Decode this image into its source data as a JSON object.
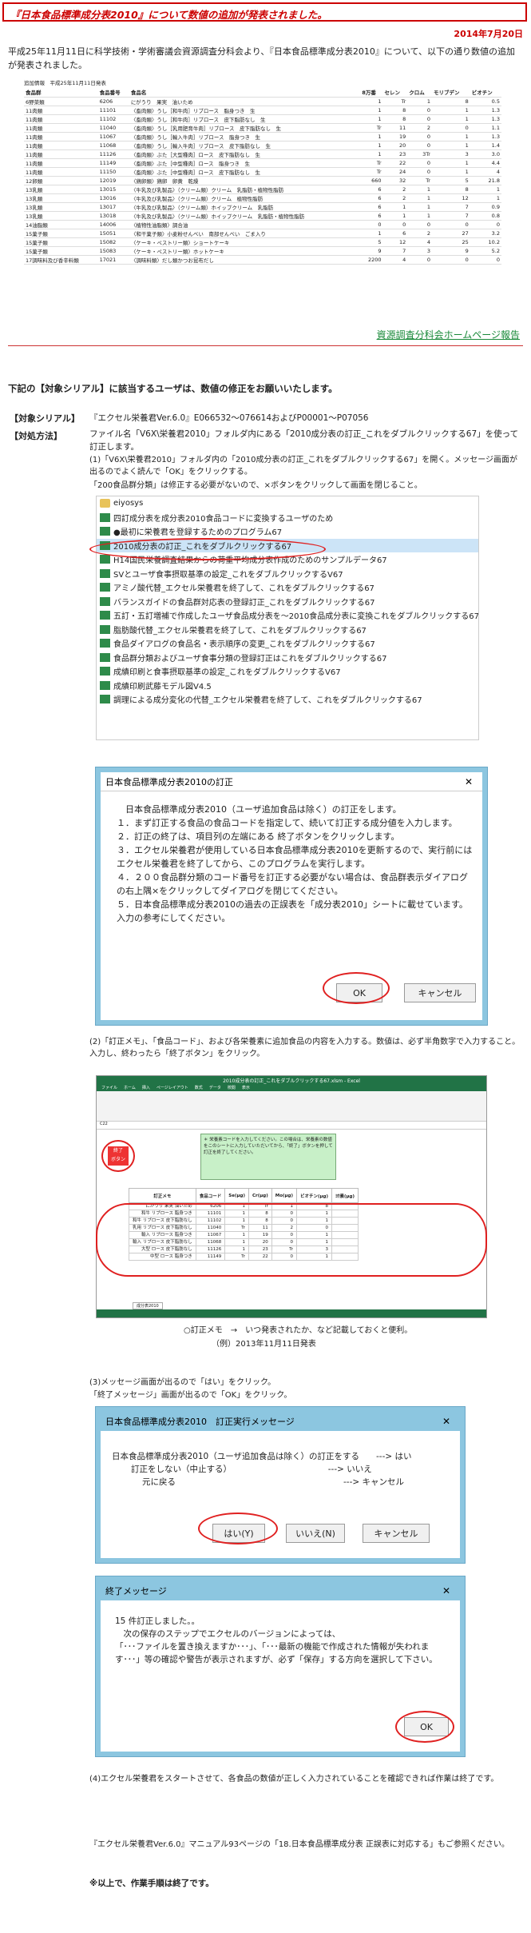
{
  "header": {
    "title": "『日本食品標準成分表2010』について数値の追加が発表されました。",
    "date": "2014年7月20日"
  },
  "intro": "平成25年11月11日に科学技術・学術審議会資源調査分科会より、『日本食品標準成分表2010』について、以下の通り数値の追加が発表されました。",
  "table": {
    "caption": "追加情報　平成25年11月11日発表",
    "columns": [
      "食品群",
      "食品番号",
      "食品名",
      "8万番",
      "セレン",
      "クロム",
      "モリブデン",
      "ビオチン"
    ],
    "rows": [
      [
        "6野菜類",
        "6206",
        "にがうり　果実　油いため",
        "1",
        "Tr",
        "1",
        "8",
        "0.5"
      ],
      [
        "11肉類",
        "11101",
        "〈畜肉類〉うし［和牛肉］リブロース　脂身つき　生",
        "1",
        "8",
        "0",
        "1",
        "1.3"
      ],
      [
        "11肉類",
        "11102",
        "〈畜肉類〉うし［和牛肉］リブロース　皮下脂肪なし　生",
        "1",
        "8",
        "0",
        "1",
        "1.3"
      ],
      [
        "11肉類",
        "11040",
        "〈畜肉類〉うし［乳用肥育牛肉］リブロース　皮下脂肪なし　生",
        "Tr",
        "11",
        "2",
        "0",
        "1.1"
      ],
      [
        "11肉類",
        "11067",
        "〈畜肉類〉うし［輸入牛肉］リブロース　脂身つき　生",
        "1",
        "19",
        "0",
        "1",
        "1.3"
      ],
      [
        "11肉類",
        "11068",
        "〈畜肉類〉うし［輸入牛肉］リブロース　皮下脂肪なし　生",
        "1",
        "20",
        "0",
        "1",
        "1.4"
      ],
      [
        "11肉類",
        "11126",
        "〈畜肉類〉ぶた［大型種肉］ロース　皮下脂肪なし　生",
        "1",
        "23",
        "3Tr",
        "3",
        "3.0"
      ],
      [
        "11肉類",
        "11149",
        "〈畜肉類〉ぶた［中型種肉］ロース　脂身つき　生",
        "Tr",
        "22",
        "0",
        "1",
        "4.4"
      ],
      [
        "11肉類",
        "11150",
        "〈畜肉類〉ぶた［中型種肉］ロース　皮下脂肪なし　生",
        "Tr",
        "24",
        "0",
        "1",
        "4"
      ],
      [
        "12卵類",
        "12019",
        "〈鶏卵類〉鶏卵　卵黄　乾燥",
        "660",
        "32",
        "Tr",
        "5",
        "21.8"
      ],
      [
        "13乳類",
        "13015",
        "〈牛乳及び乳製品〉（クリーム類）クリーム　乳脂肪・植物性脂肪",
        "6",
        "2",
        "1",
        "8",
        "1"
      ],
      [
        "13乳類",
        "13016",
        "〈牛乳及び乳製品〉（クリーム類）クリーム　植物性脂肪",
        "6",
        "2",
        "1",
        "12",
        "1"
      ],
      [
        "13乳類",
        "13017",
        "〈牛乳及び乳製品〉（クリーム類）ホイップクリーム　乳脂肪",
        "6",
        "1",
        "1",
        "7",
        "0.9"
      ],
      [
        "13乳類",
        "13018",
        "〈牛乳及び乳製品〉（クリーム類）ホイップクリーム　乳脂肪・植物性脂肪",
        "6",
        "1",
        "1",
        "7",
        "0.8"
      ],
      [
        "14油脂類",
        "14006",
        "〈植物性油脂類〉調合油",
        "0",
        "0",
        "0",
        "0",
        "0"
      ],
      [
        "15菓子類",
        "15051",
        "〈和干菓子類〉小麦粉せんべい　南部せんべい　ごま入り",
        "1",
        "6",
        "2",
        "27",
        "3.2"
      ],
      [
        "15菓子類",
        "15082",
        "〈ケーキ・ペストリー類〉ショートケーキ",
        "5",
        "12",
        "4",
        "25",
        "10.2"
      ],
      [
        "15菓子類",
        "15083",
        "〈ケーキ・ペストリー類〉ホットケーキ",
        "9",
        "7",
        "3",
        "9",
        "5.2"
      ],
      [
        "17調味料及び香辛料類",
        "17021",
        "〈調味料類〉だし類かつお昆布だし",
        "2200",
        "4",
        "0",
        "0",
        "0"
      ]
    ]
  },
  "links": {
    "shigen": "資源調査分科会ホームページ報告"
  },
  "notice": "下記の【対象シリアル】に該当するユーザは、数値の修正をお願いいたします。",
  "serial": {
    "label": "【対象シリアル】",
    "text": "『エクセル栄養君Ver.6.0』E066532～076614およびP00001～P07056"
  },
  "method": {
    "label": "【対処方法】",
    "p1": "ファイル名「V6X\\栄養君2010」フォルダ内にある「2010成分表の訂正_これをダブルクリックする67」を使って訂正します。",
    "p2": "(1)「V6X\\栄養君2010」フォルダ内の「2010成分表の訂正_これをダブルクリックする67」を開く。メッセージ画面が出るのでよく読んで「OK」をクリックする。",
    "p3": "「200食品群分類」は修正する必要がないので、×ボタンをクリックして画面を閉じること。"
  },
  "folder": [
    "eiyosys",
    "四訂成分表を成分表2010食品コードに変換するユーザのため",
    "●最初に栄養君を登録するためのプログラム67",
    "2010成分表の訂正_これをダブルクリックする67",
    "H14国民栄養調査結果からの荷重平均成分表作成のためのサンプルデータ67",
    "SVとユーザ食事摂取基準の設定_これをダブルクリックするV67",
    "アミノ酸代替_エクセル栄養君を終了して、これをダブルクリックする67",
    "バランスガイドの食品群対応表の登録訂正_これをダブルクリックする67",
    "五訂・五訂増補で作成したユーザ食品成分表を～2010食品成分表に変換これをダブルクリックする67",
    "脂肪酸代替_エクセル栄養君を終了して、これをダブルクリックする67",
    "食品ダイアログの食品名・表示順序の変更_これをダブルクリックする67",
    "食品群分類およびユーザ食事分類の登録訂正はこれをダブルクリックする67",
    "成績印刷と食事摂取基準の設定_これをダブルクリックするV67",
    "成績印刷武藤モデル図V4.5",
    "調理による成分変化の代替_エクセル栄養君を終了して、これをダブルクリックする67"
  ],
  "dialog1": {
    "title": "日本食品標準成分表2010の訂正",
    "body": "　日本食品標準成分表2010（ユーザ追加食品は除く）の訂正をします。\n１．まず訂正する食品の食品コードを指定して、続いて訂正する成分値を入力します。\n２．訂正の終了は、項目列の左端にある 終了ボタンをクリックします。\n３．エクセル栄養君が使用している日本食品標準成分表2010を更新するので、実行前にはエクセル栄養君を終了してから、このプログラムを実行します。\n４．２００食品群分類のコード番号を訂正する必要がない場合は、食品群表示ダイアログの右上隅×をクリックしてダイアログを閉じてください。\n５．日本食品標準成分表2010の過去の正誤表を「成分表2010」シートに載せています。入力の参考にしてください。",
    "ok": "OK",
    "cancel": "キャンセル"
  },
  "step2": "(2)「訂正メモ」、「食品コード」、および各栄養素に追加食品の内容を入力する。数値は、必ず半角数字で入力すること。入力し、終わったら「終了ボタン」をクリック。",
  "excel": {
    "title": "2010成分表の訂正_これをダブルクリックする67.xlsm - Excel",
    "tabs": [
      "ファイル",
      "ホーム",
      "挿入",
      "ページレイアウト",
      "数式",
      "データ",
      "校閲",
      "表示"
    ],
    "end_button": "終了\nボタン",
    "note": "＊ 栄養素コードを入力してください。この場合は、栄養素の数値をこのシートに入力していただいてから、「終了」ボタンを押して訂正を終了してください。",
    "headers": [
      "訂正メモ",
      "食品コード",
      "Se(μg)",
      "Cr(μg)",
      "Mo(μg)",
      "ビオチン(μg)",
      "ﾖｳ素(μg)"
    ],
    "rows": [
      [
        "にがうり 果実 油いため",
        "6206",
        "1",
        "Tr",
        "1",
        "8"
      ],
      [
        "和牛 リブロース 脂身つき",
        "11101",
        "1",
        "8",
        "0",
        "1"
      ],
      [
        "和牛 リブロース 皮下脂肪なし",
        "11102",
        "1",
        "8",
        "0",
        "1"
      ],
      [
        "乳用 リブロース 皮下脂肪なし",
        "11040",
        "Tr",
        "11",
        "2",
        "0"
      ],
      [
        "輸入 リブロース 脂身つき",
        "11067",
        "1",
        "19",
        "0",
        "1"
      ],
      [
        "輸入 リブロース 皮下脂肪なし",
        "11068",
        "1",
        "20",
        "0",
        "1"
      ],
      [
        "大型 ロース 皮下脂肪なし",
        "11126",
        "1",
        "23",
        "Tr",
        "3"
      ],
      [
        "中型 ロース 脂身つき",
        "11149",
        "Tr",
        "22",
        "0",
        "1"
      ]
    ],
    "sheet_tab": "成分表2010"
  },
  "caption2a": "○訂正メモ　→　いつ発表されたか、など記載しておくと便利。",
  "caption2b": "（例）2013年11月11日発表",
  "step3a": "(3)メッセージ画面が出るので「はい」をクリック。",
  "step3b": "「終了メッセージ」画面が出るので「OK」をクリック。",
  "dialog2": {
    "title": "日本食品標準成分表2010　訂正実行メッセージ",
    "l1": "日本食品標準成分表2010（ユーザ追加食品は除く）の訂正をする　　---> はい",
    "l2": "訂正をしない（中止する）　　　　　　　　　　　　---> いいえ",
    "l3": "元に戻る　　　　　　　　　　　　　　　　　　　　---> キャンセル",
    "yes": "はい(Y)",
    "no": "いいえ(N)",
    "cancel": "キャンセル"
  },
  "dialog3": {
    "title": "終了メッセージ",
    "body": "15 件訂正しました。。\n　次の保存のステップでエクセルのバージョンによっては、\n「･･･ファイルを置き換えますか･･･」、「･･･最新の機能で作成された情報が失われます･･･」等の確認や警告が表示されますが、必ず「保存」する方向を選択して下さい。",
    "ok": "OK"
  },
  "step4": "(4)エクセル栄養君をスタートさせて、各食品の数値が正しく入力されていることを確認できれば作業は終了です。",
  "manual": "『エクセル栄養君Ver.6.0』マニュアル93ページの「18.日本食品標準成分表 正誤表に対応する」もご参照ください。",
  "final": "※以上で、作業手順は終了です。"
}
